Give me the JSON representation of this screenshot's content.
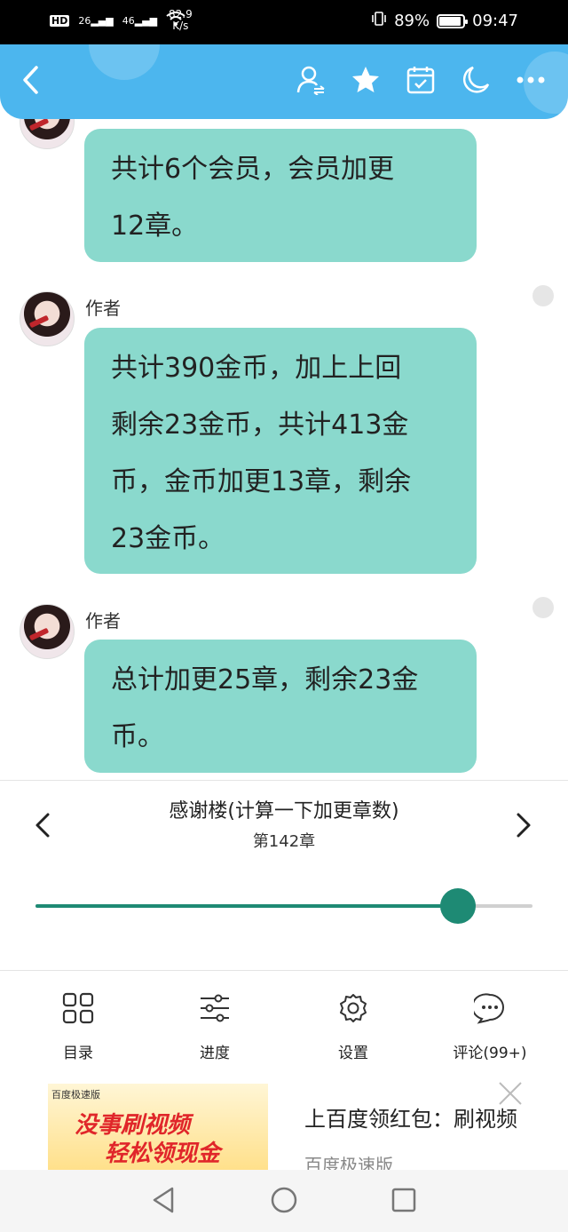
{
  "status_bar": {
    "hd": "HD",
    "net1": "26",
    "net2": "46",
    "speed_value": "82.9",
    "speed_unit": "K/s",
    "battery": "89%",
    "time": "09:47"
  },
  "header": {
    "icons": [
      "back-icon",
      "user-switch-icon",
      "star-icon",
      "calendar-check-icon",
      "moon-icon",
      "more-icon"
    ]
  },
  "messages": [
    {
      "author": "",
      "text": "共计6个会员，会员加更\n12章。"
    },
    {
      "author": "作者",
      "text": "共计390金币，加上上回\n剩余23金币，共计413金\n币，金币加更13章，剩余\n23金币。"
    },
    {
      "author": "作者",
      "text": "总计加更25章，剩余23金\n币。"
    }
  ],
  "chapter_nav": {
    "title": "感谢楼(计算一下加更章数)",
    "chapter": "第142章",
    "progress": 0.85
  },
  "toolbar": [
    {
      "label": "目录",
      "icon": "grid-icon"
    },
    {
      "label": "进度",
      "icon": "sliders-icon"
    },
    {
      "label": "设置",
      "icon": "gear-icon"
    },
    {
      "label": "评论(99+)",
      "icon": "comment-icon"
    }
  ],
  "ad": {
    "image_brand": "百度极速版",
    "image_line1": "没事刷视频",
    "image_line2": "轻松领现金",
    "title": "上百度领红包：刷视频",
    "source": "百度极速版"
  },
  "colors": {
    "header": "#4cb6ee",
    "bubble": "#8ad9cd",
    "slider": "#1e8a74"
  }
}
